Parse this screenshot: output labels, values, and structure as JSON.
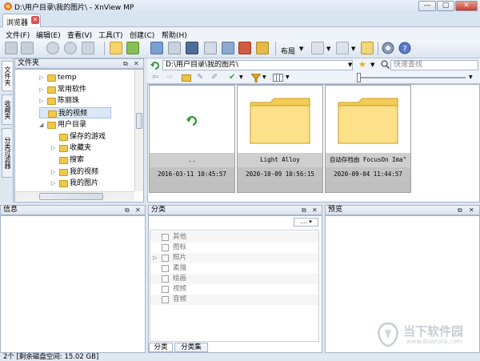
{
  "window": {
    "title": "D:\\用户目录\\我的图片\\ - XnView MP",
    "minimize": "—",
    "maximize": "▢",
    "close": "✕"
  },
  "tab": {
    "label": "浏览器",
    "close": "✕"
  },
  "menu": [
    "文件(F)",
    "编辑(E)",
    "查看(V)",
    "工具(T)",
    "创建(C)",
    "帮助(H)"
  ],
  "toolbar": {
    "layout_label": "布局"
  },
  "sidebar": {
    "vertical_tabs": [
      "文件夹",
      "收藏夹",
      "分类过滤器"
    ],
    "folder_panel_title": "文件夹",
    "tree": [
      {
        "label": "temp",
        "indent": 1,
        "arrow": "▷"
      },
      {
        "label": "常用软件",
        "indent": 1,
        "arrow": "▷"
      },
      {
        "label": "陈丽珠",
        "indent": 1,
        "arrow": "▷"
      },
      {
        "label": "我的视频",
        "indent": 1,
        "arrow": "",
        "selected": true
      },
      {
        "label": "用户目录",
        "indent": 1,
        "arrow": "◢"
      },
      {
        "label": "保存的游戏",
        "indent": 2,
        "arrow": ""
      },
      {
        "label": "收藏夹",
        "indent": 2,
        "arrow": "▷"
      },
      {
        "label": "搜索",
        "indent": 2,
        "arrow": ""
      },
      {
        "label": "我的视频",
        "indent": 2,
        "arrow": "▷"
      },
      {
        "label": "我的图片",
        "indent": 2,
        "arrow": "▷"
      }
    ]
  },
  "addressbar": {
    "path": "D:\\用户目录\\我的图片\\",
    "search_placeholder": "快速查找"
  },
  "thumbnails": [
    {
      "name": "..",
      "date": "2016-03-11 10:45:57",
      "kind": "parent"
    },
    {
      "name": "Light Alloy",
      "date": "2020-10-09 10:56:15",
      "kind": "folder"
    },
    {
      "name": "自动存档由 FocusOn Ima\"",
      "date": "2020-09-04 11:44:57",
      "kind": "folder"
    }
  ],
  "panels": {
    "info_title": "信息",
    "category_title": "分类",
    "preview_title": "预览",
    "category_combo": "....",
    "categories": [
      "其他",
      "图标",
      "照片",
      "素描",
      "绘画",
      "视频",
      "音频"
    ],
    "category_tabs": [
      "分类",
      "分类集"
    ]
  },
  "status": "2个 [剩余磁盘空间: 15.02 GB]",
  "watermark": {
    "text": "当下软件园",
    "url": "www.downxia.com"
  }
}
